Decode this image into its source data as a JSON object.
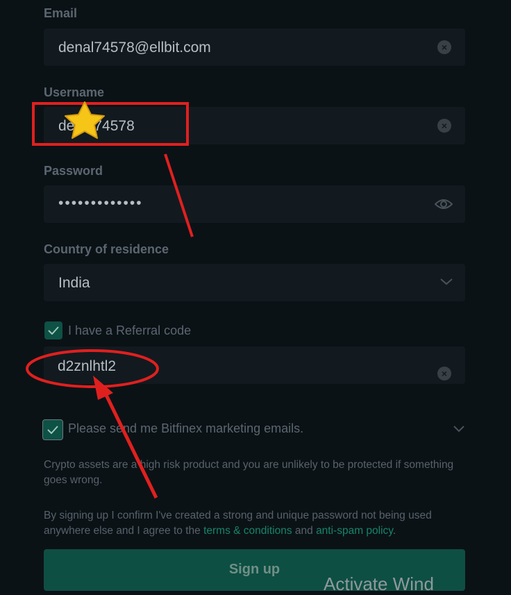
{
  "form": {
    "email_label": "Email",
    "email_value": "denal74578@ellbit.com",
    "username_label": "Username",
    "username_value": "denal74578",
    "password_label": "Password",
    "password_value": "•••••••••••••",
    "country_label": "Country of residence",
    "country_value": "India",
    "referral_checkbox_label": "I have a Referral code",
    "referral_checked": true,
    "referral_value": "d2znlhtl2",
    "marketing_checkbox_label": "Please send me Bitfinex marketing emails.",
    "marketing_checked": true,
    "risk_text": "Crypto assets are a high risk product and you are unlikely to be protected if something goes wrong.",
    "terms_prefix": "By signing up I confirm I've created a strong and unique password not being used anywhere else and I agree to the ",
    "terms_link": "terms & conditions",
    "terms_and": " and ",
    "antispam_link": "anti-spam policy",
    "terms_suffix": ".",
    "signup_label": "Sign up"
  },
  "watermark": "Activate Wind",
  "colors": {
    "background": "#0b1216",
    "field_bg": "#121a1f",
    "accent": "#16856a",
    "annotation_red": "#e0201f",
    "star": "#f5c518"
  },
  "icons": [
    "clear-icon",
    "eye-icon",
    "chevron-down-icon",
    "check-icon",
    "star-icon"
  ]
}
